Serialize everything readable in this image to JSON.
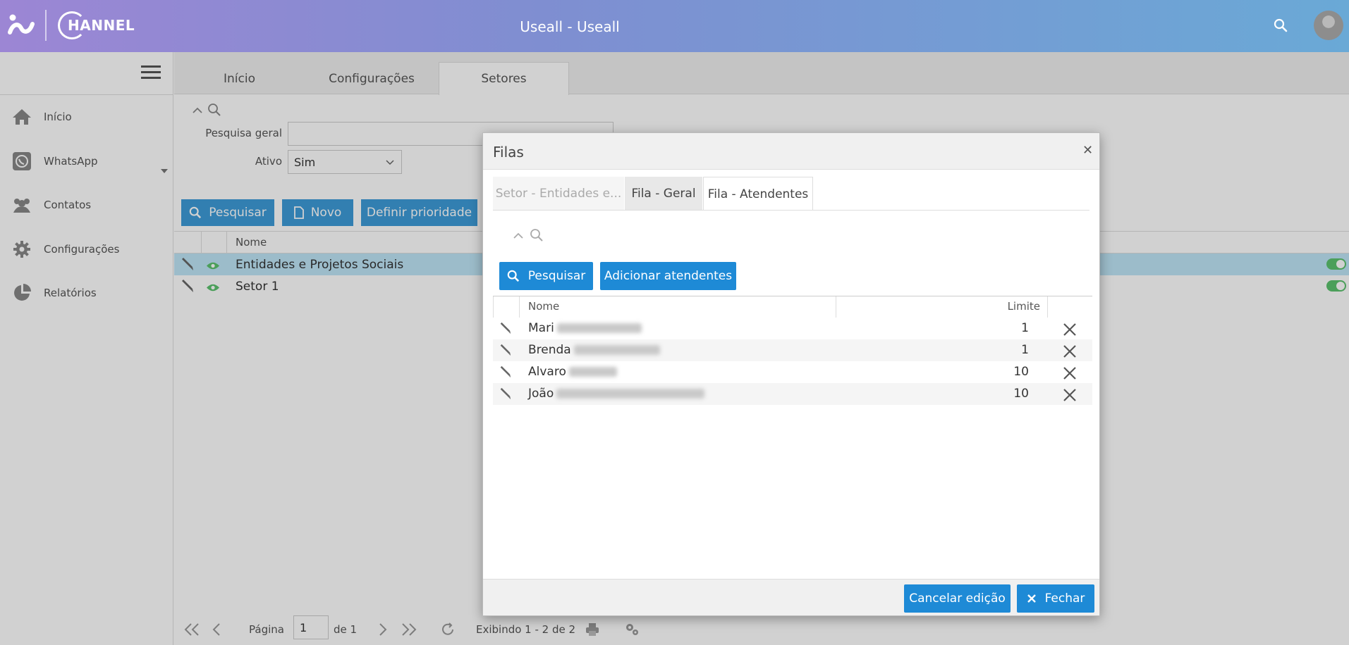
{
  "header": {
    "logo_text": "HANNEL",
    "title": "Useall - Useall"
  },
  "sidebar": {
    "items": [
      {
        "label": "Início",
        "icon": "home-icon"
      },
      {
        "label": "WhatsApp",
        "icon": "whatsapp-icon"
      },
      {
        "label": "Contatos",
        "icon": "contacts-icon"
      },
      {
        "label": "Configurações",
        "icon": "gear-icon"
      },
      {
        "label": "Relatórios",
        "icon": "pie-chart-icon"
      }
    ]
  },
  "main": {
    "tabs": [
      {
        "label": "Início"
      },
      {
        "label": "Configurações"
      },
      {
        "label": "Setores",
        "active": true
      }
    ],
    "filter": {
      "search_label": "Pesquisa geral",
      "search_value": "",
      "active_label": "Ativo",
      "active_value": "Sim"
    },
    "buttons": {
      "search": "Pesquisar",
      "new": "Novo",
      "priority": "Definir prioridade"
    },
    "grid": {
      "column_name": "Nome",
      "rows": [
        {
          "name": "Entidades e Projetos Sociais",
          "selected": true,
          "active": true
        },
        {
          "name": "Setor 1",
          "selected": false,
          "active": true
        }
      ]
    },
    "pager": {
      "page_label": "Página",
      "page_value": "1",
      "of_label": "de 1",
      "showing": "Exibindo 1 - 2 de 2"
    }
  },
  "dialog": {
    "title": "Filas",
    "tabs": [
      {
        "label": "Setor - Entidades e..."
      },
      {
        "label": "Fila - Geral"
      },
      {
        "label": "Fila - Atendentes",
        "active": true
      }
    ],
    "buttons": {
      "search": "Pesquisar",
      "add": "Adicionar atendentes",
      "cancel": "Cancelar edição",
      "close": "Fechar"
    },
    "grid": {
      "col_name": "Nome",
      "col_limit": "Limite",
      "rows": [
        {
          "name": "Mari",
          "limit": "1"
        },
        {
          "name": "Brenda",
          "limit": "1"
        },
        {
          "name": "Alvaro",
          "limit": "10"
        },
        {
          "name": "João",
          "limit": "10"
        }
      ]
    }
  },
  "colors": {
    "primary": "#1e8ad6",
    "selected_row": "#bfe6f7",
    "toggle_on": "#5cc26e"
  }
}
